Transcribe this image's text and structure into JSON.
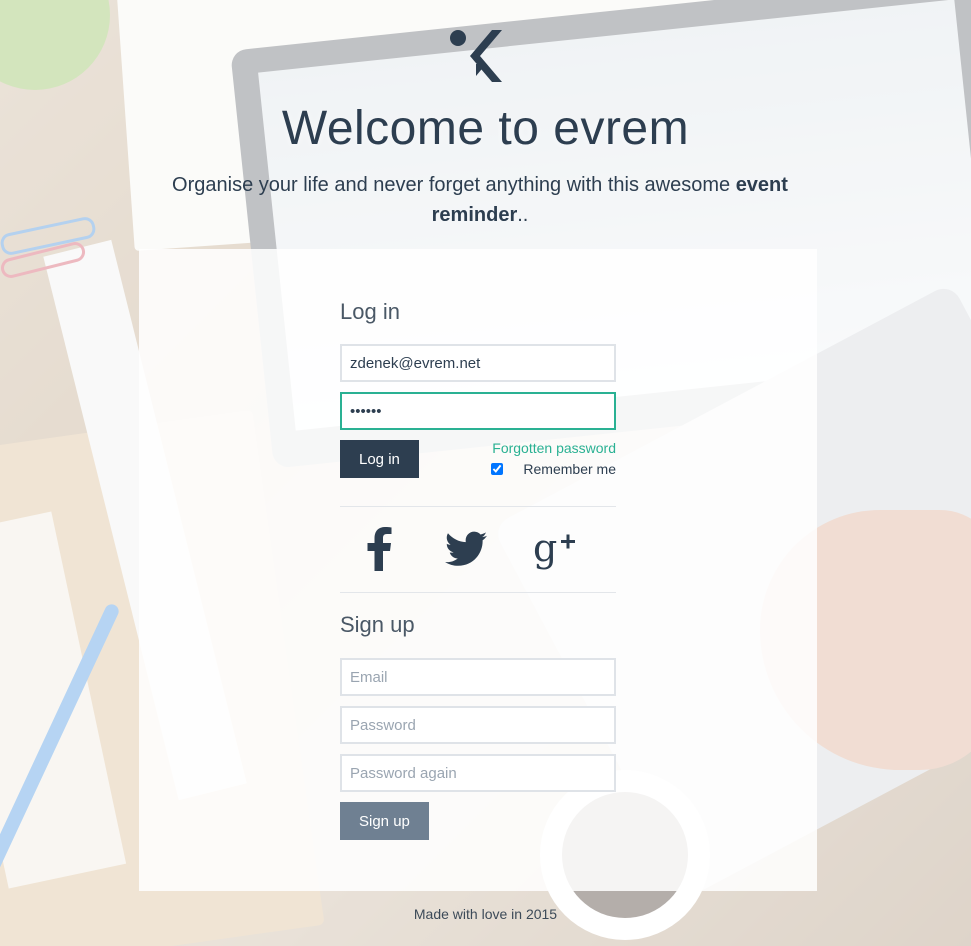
{
  "header": {
    "title": "Welcome to evrem",
    "tagline_prefix": "Organise your life and never forget anything with this awesome",
    "tagline_bold": "event reminder",
    "tagline_suffix": ".."
  },
  "login": {
    "heading": "Log in",
    "email_value": "zdenek@evrem.net",
    "password_value": "••••••",
    "submit_label": "Log in",
    "forgot_label": "Forgotten password",
    "remember_label": "Remember me",
    "remember_checked": true
  },
  "social": {
    "items": [
      {
        "name": "facebook-icon"
      },
      {
        "name": "twitter-icon"
      },
      {
        "name": "google-plus-icon"
      }
    ]
  },
  "signup": {
    "heading": "Sign up",
    "email_placeholder": "Email",
    "password_placeholder": "Password",
    "password_again_placeholder": "Password again",
    "submit_label": "Sign up"
  },
  "footer": {
    "text": "Made with love in 2015"
  },
  "colors": {
    "primary": "#2d3e50",
    "accent": "#2ab193",
    "signup_button": "#6f8092"
  }
}
